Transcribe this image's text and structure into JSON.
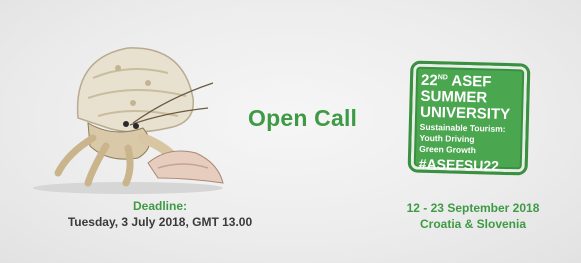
{
  "banner": {
    "headline": "Open Call",
    "deadline": {
      "label": "Deadline:",
      "value": "Tuesday, 3 July 2018, GMT 13.00"
    },
    "stamp": {
      "edition_number": "22",
      "edition_suffix": "ND",
      "line1_rest": " ASEF",
      "line2": "SUMMER",
      "line3": "UNIVERSITY",
      "sub1": "Sustainable Tourism:",
      "sub2": "Youth Driving",
      "sub3": "Green Growth",
      "hashtag": "#ASEFSU22"
    },
    "event": {
      "dates": "12 - 23 September 2018",
      "location": "Croatia & Slovenia"
    },
    "image": {
      "icon": "hermit-crab-with-shell"
    },
    "colors": {
      "accent": "#3f9a45",
      "stamp_fill": "#4aa64f",
      "background": "#ececec"
    }
  }
}
